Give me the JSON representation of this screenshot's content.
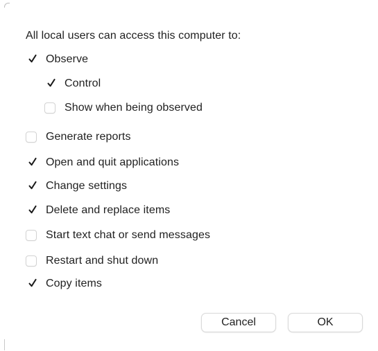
{
  "dialog": {
    "heading": "All local users can access this computer to:",
    "options": [
      {
        "label": "Observe",
        "checked": true
      },
      {
        "label": "Control",
        "checked": true
      },
      {
        "label": "Show when being observed",
        "checked": false
      },
      {
        "label": "Generate reports",
        "checked": false
      },
      {
        "label": "Open and quit applications",
        "checked": true
      },
      {
        "label": "Change settings",
        "checked": true
      },
      {
        "label": "Delete and replace items",
        "checked": true
      },
      {
        "label": "Start text chat or send messages",
        "checked": false
      },
      {
        "label": "Restart and shut down",
        "checked": false
      },
      {
        "label": "Copy items",
        "checked": true
      }
    ],
    "buttons": {
      "cancel": "Cancel",
      "ok": "OK"
    }
  },
  "colors": {
    "text": "#1f1f1f",
    "checkbox_border": "#d3d3d3",
    "background": "#ffffff"
  }
}
